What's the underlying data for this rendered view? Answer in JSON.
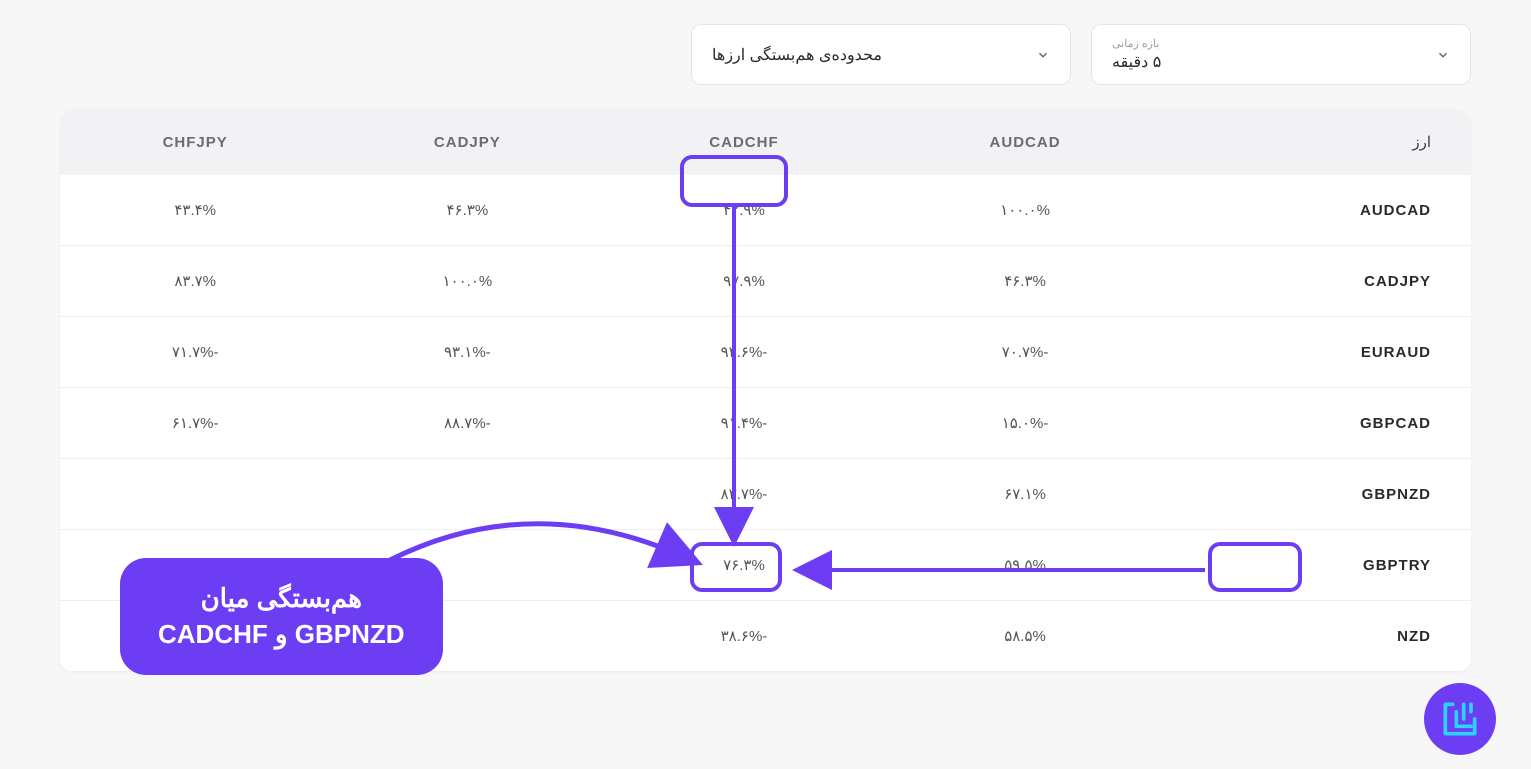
{
  "filters": {
    "timeframe": {
      "label": "بازه زمانی",
      "value": "۵ دقیقه"
    },
    "range": {
      "label": "",
      "value": "محدوده‌ی هم‌بستگی ارزها"
    }
  },
  "table": {
    "row_header_label": "ارز",
    "col_headers": [
      "AUDCAD",
      "CADCHF",
      "CADJPY",
      "CHFJPY"
    ],
    "rows": [
      {
        "name": "AUDCAD",
        "values": [
          "۱۰۰.۰%",
          "۴۲.۹%",
          "۴۶.۳%",
          "۴۳.۴%"
        ]
      },
      {
        "name": "CADJPY",
        "values": [
          "۴۶.۳%",
          "۹۷.۹%",
          "۱۰۰.۰%",
          "۸۳.۷%"
        ]
      },
      {
        "name": "EURAUD",
        "values": [
          "-۷۰.۷%",
          "-۹۲.۶%",
          "-۹۳.۱%",
          "-۷۱.۷%"
        ]
      },
      {
        "name": "GBPCAD",
        "values": [
          "-۱۵.۰%",
          "-۹۱.۴%",
          "-۸۸.۷%",
          "-۶۱.۷%"
        ]
      },
      {
        "name": "GBPNZD",
        "values": [
          "۶۷.۱%",
          "-۸۳.۷%",
          "",
          ""
        ]
      },
      {
        "name": "GBPTRY",
        "values": [
          "۵۹.۵%",
          "۷۶.۳%",
          "",
          ""
        ]
      },
      {
        "name": "NZD",
        "values": [
          "۵۸.۵%",
          "-۳۸.۶%",
          "",
          ""
        ]
      }
    ]
  },
  "tooltip": {
    "line1": "هم‌بستگی میان",
    "line2": "CADCHF و GBPNZD"
  }
}
